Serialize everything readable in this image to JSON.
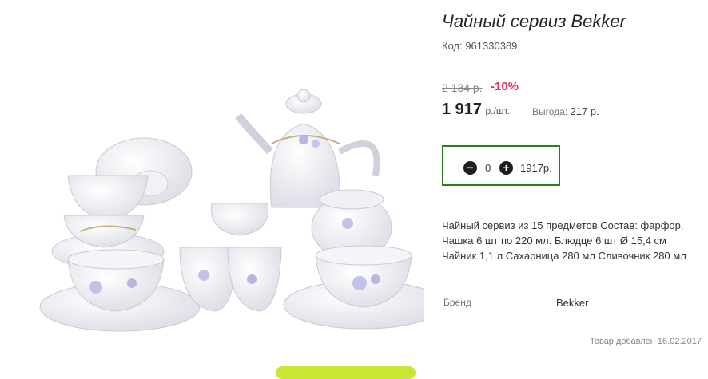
{
  "product": {
    "title": "Чайный сервиз Bekker",
    "code": "Код: 961330389",
    "old_price": "2 134 р.",
    "discount": "-10%",
    "price": "1 917",
    "price_unit": "р./шт.",
    "saving_label": "Выгода:",
    "saving_value": "217 р.",
    "quantity": {
      "minus_icon": "minus-circle-icon",
      "value": "0",
      "plus_icon": "plus-circle-icon",
      "total": "1917р."
    },
    "description": "Чайный сервиз из 15 предметов Состав: фарфор. Чашка 6 шт по 220 мл. Блюдце 6 шт Ø 15,4 см Чайник 1,1 л Сахарница 280 мл Сливочник 280 мл",
    "brand_label": "Бренд",
    "brand_value": "Bekker",
    "added_date": "Товар добавлен 16.02.2017"
  },
  "colors": {
    "accent_green": "#2e7d1f",
    "discount_red": "#e8305a",
    "button_lime": "#c8e632"
  }
}
